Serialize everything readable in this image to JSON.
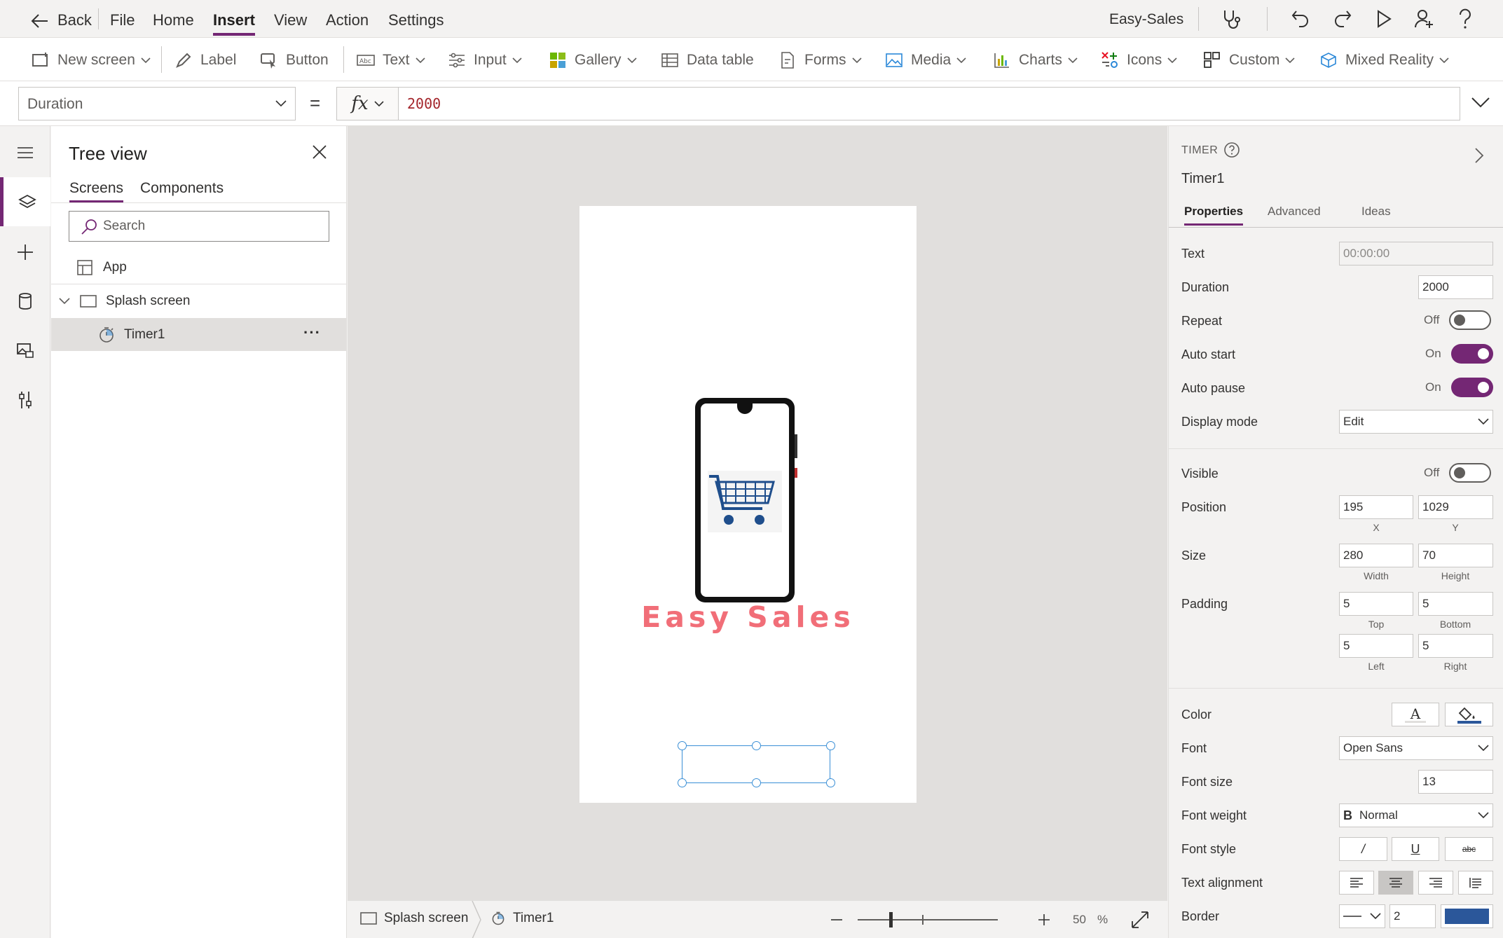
{
  "topbar": {
    "back": "Back",
    "menus": [
      "File",
      "Home",
      "Insert",
      "View",
      "Action",
      "Settings"
    ],
    "app_name": "Easy-Sales"
  },
  "ribbon": {
    "new_screen": "New screen",
    "label": "Label",
    "button": "Button",
    "text": "Text",
    "input": "Input",
    "gallery": "Gallery",
    "data_table": "Data table",
    "forms": "Forms",
    "media": "Media",
    "charts": "Charts",
    "icons": "Icons",
    "custom": "Custom",
    "mixed_reality": "Mixed Reality"
  },
  "formula": {
    "property": "Duration",
    "equals": "=",
    "fx": "fx",
    "value": "2000"
  },
  "tree": {
    "title": "Tree view",
    "tabs": [
      "Screens",
      "Components"
    ],
    "search_placeholder": "Search",
    "items": [
      "App",
      "Splash screen",
      "Timer1"
    ],
    "more": "···"
  },
  "canvas": {
    "brand": "Easy Sales"
  },
  "status": {
    "screen": "Splash screen",
    "control": "Timer1",
    "zoom": "50",
    "zoom_unit": "%",
    "zoom_level": 0.5
  },
  "props": {
    "type": "TIMER",
    "name": "Timer1",
    "tabs": [
      "Properties",
      "Advanced",
      "Ideas"
    ],
    "text_label": "Text",
    "text_value": "00:00:00",
    "duration_label": "Duration",
    "duration_value": "2000",
    "repeat_label": "Repeat",
    "repeat_state": "Off",
    "autostart_label": "Auto start",
    "autostart_state": "On",
    "autopause_label": "Auto pause",
    "autopause_state": "On",
    "displaymode_label": "Display mode",
    "displaymode_value": "Edit",
    "visible_label": "Visible",
    "visible_state": "Off",
    "position_label": "Position",
    "pos_x": "195",
    "pos_y": "1029",
    "x_label": "X",
    "y_label": "Y",
    "size_label": "Size",
    "width": "280",
    "height": "70",
    "width_label": "Width",
    "height_label": "Height",
    "padding_label": "Padding",
    "pad_top": "5",
    "pad_bottom": "5",
    "pad_left": "5",
    "pad_right": "5",
    "top_label": "Top",
    "bottom_label": "Bottom",
    "left_label": "Left",
    "right_label": "Right",
    "color_label": "Color",
    "color_text_glyph": "A",
    "font_label": "Font",
    "font_value": "Open Sans",
    "fontsize_label": "Font size",
    "fontsize_value": "13",
    "fontweight_label": "Font weight",
    "fontweight_glyph": "B",
    "fontweight_value": "Normal",
    "fontstyle_label": "Font style",
    "italic_glyph": "/",
    "underline_glyph": "U",
    "strike_glyph": "abc",
    "align_label": "Text alignment",
    "border_label": "Border",
    "border_width": "2",
    "border_color": "#2b579a",
    "accent_color": "#742774"
  }
}
